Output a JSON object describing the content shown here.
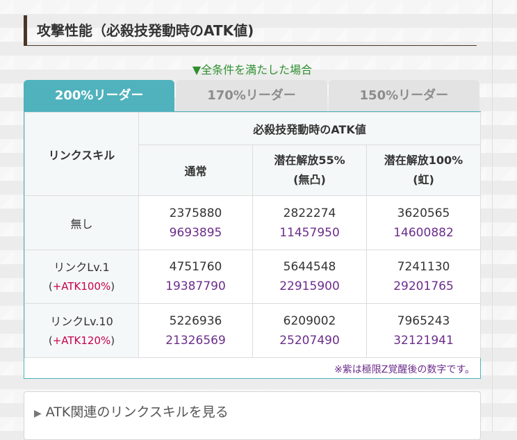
{
  "heading": "攻撃性能（必殺技発動時のATK値)",
  "condition_note": "▼全条件を満たした場合",
  "tabs": [
    {
      "label": "200%リーダー",
      "active": true
    },
    {
      "label": "170%リーダー",
      "active": false
    },
    {
      "label": "150%リーダー",
      "active": false
    }
  ],
  "table": {
    "corner_header": "リンクスキル",
    "group_header": "必殺技発動時のATK値",
    "columns": [
      {
        "line1": "通常",
        "line2": ""
      },
      {
        "line1": "潜在解放55%",
        "line2": "(無凸)"
      },
      {
        "line1": "潜在解放100%",
        "line2": "(虹)"
      }
    ],
    "rows": [
      {
        "label": "無し",
        "sub": "",
        "values": [
          {
            "base": "2375880",
            "awakened": "9693895"
          },
          {
            "base": "2822274",
            "awakened": "11457950"
          },
          {
            "base": "3620565",
            "awakened": "14600882"
          }
        ]
      },
      {
        "label": "リンクLv.1",
        "sub_open": "(",
        "sub": "+ATK100%",
        "sub_close": ")",
        "values": [
          {
            "base": "4751760",
            "awakened": "19387790"
          },
          {
            "base": "5644548",
            "awakened": "22915900"
          },
          {
            "base": "7241130",
            "awakened": "29201765"
          }
        ]
      },
      {
        "label": "リンクLv.10",
        "sub_open": "(",
        "sub": "+ATK120%",
        "sub_close": ")",
        "values": [
          {
            "base": "5226936",
            "awakened": "21326569"
          },
          {
            "base": "6209002",
            "awakened": "25207490"
          },
          {
            "base": "7965243",
            "awakened": "32121941"
          }
        ]
      }
    ],
    "footnote": "※紫は極限Z覚醒後の数字です。"
  },
  "expander": {
    "label": "ATK関連のリンクスキルを見る",
    "icon": "triangle-right-icon"
  },
  "colors": {
    "accent": "#4fb2bd",
    "heading_bar": "#4a3526",
    "awakened": "#6b2d8a",
    "bonus": "#c8004a",
    "note_green": "#2f8f2f"
  }
}
